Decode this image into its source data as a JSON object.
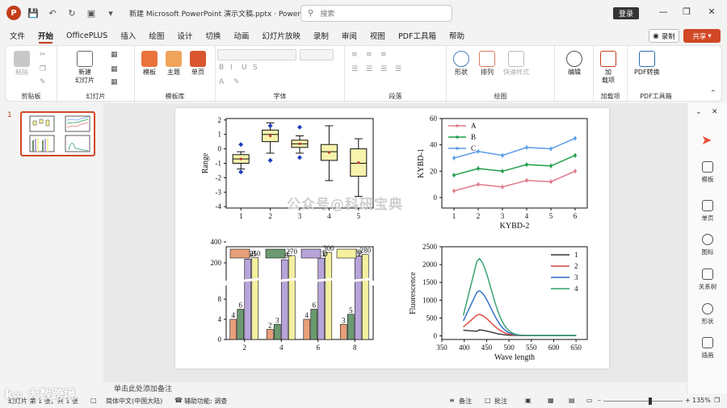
{
  "window": {
    "title": "新建 Microsoft PowerPoint 演示文稿.pptx  ·  PowerPo...",
    "search_placeholder": "搜索",
    "login": "登录"
  },
  "menu": [
    "文件",
    "开始",
    "OfficePLUS",
    "插入",
    "绘图",
    "设计",
    "切换",
    "动画",
    "幻灯片放映",
    "录制",
    "审阅",
    "视图",
    "PDF工具箱",
    "帮助"
  ],
  "record": "录制",
  "share": "共享",
  "ribbon": {
    "clipboard": {
      "label": "剪贴板",
      "paste": "粘贴"
    },
    "slides": {
      "label": "幻灯片",
      "new_slide": "新建\n幻灯片"
    },
    "templates": {
      "label": "模板库",
      "template": "模板",
      "theme": "主题",
      "single": "单页"
    },
    "font": {
      "label": "字体"
    },
    "paragraph": {
      "label": "段落"
    },
    "drawing": {
      "label": "绘图",
      "shape": "形状",
      "arrange": "排列",
      "quick_style": "快速样式"
    },
    "editing": {
      "label": "",
      "edit": "编辑"
    },
    "addins": {
      "label": "加载项",
      "addin": "加\n载项"
    },
    "pdf": {
      "label": "PDF工具箱",
      "convert": "PDF转换"
    }
  },
  "slide_number": "1",
  "watermark": "公众号@科研宝典",
  "notes_placeholder": "单击此处添加备注",
  "status": {
    "slide_info": "幻灯片 第 1 张，共 1 张",
    "language": "简体中文(中国大陆)",
    "accessibility": "辅助功能: 调查",
    "notes": "备注",
    "comments": "批注",
    "zoom": "135%"
  },
  "right_pane": [
    "模板",
    "单页",
    "图标",
    "关系树",
    "形状",
    "插画"
  ],
  "bilibili": "k∞ 大数跨境",
  "colors": {
    "accent": "#c43e1c",
    "share": "#d24726"
  },
  "charts": {
    "box": {
      "ylabel": "Range",
      "yticks": [
        "2",
        "1",
        "0",
        "-1",
        "-2",
        "-3",
        "-4"
      ],
      "xticks": [
        "1",
        "2",
        "3",
        "4",
        "5"
      ]
    },
    "line": {
      "ylabel": "KYBD-1",
      "xlabel": "KYBD-2",
      "yticks": [
        "60",
        "40",
        "20",
        "0"
      ],
      "xticks": [
        "1",
        "2",
        "3",
        "4",
        "5",
        "6"
      ],
      "legend": [
        "A",
        "B",
        "C"
      ]
    },
    "bar": {
      "yticks": [
        "400",
        "200",
        "8",
        "4",
        "0"
      ],
      "xticks": [
        "2",
        "4",
        "6",
        "8"
      ],
      "legend": [
        "B",
        "C",
        "D",
        "E"
      ],
      "labels": [
        "4",
        "6",
        "20",
        "250",
        "2",
        "3",
        "18",
        "270",
        "4",
        "6",
        "23",
        "300",
        "3",
        "5",
        "30",
        "280"
      ]
    },
    "fluor": {
      "ylabel": "Fluorescence",
      "xlabel": "Wave length",
      "yticks": [
        "2500",
        "2000",
        "1500",
        "1000",
        "500",
        "0"
      ],
      "xticks": [
        "350",
        "400",
        "450",
        "500",
        "550",
        "600",
        "650"
      ],
      "legend": [
        "1",
        "2",
        "3",
        "4"
      ]
    }
  }
}
